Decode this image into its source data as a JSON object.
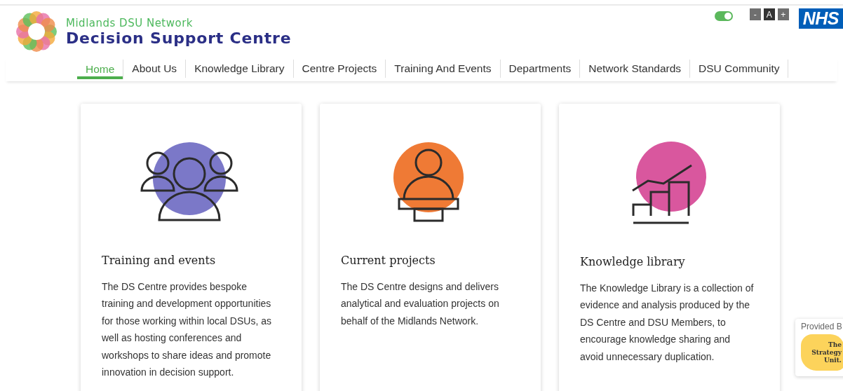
{
  "header": {
    "subtitle": "Midlands DSU Network",
    "title": "Decision Support Centre"
  },
  "contrast_toggle": {
    "on": true
  },
  "font_size_buttons": [
    {
      "label": "-",
      "selected": false
    },
    {
      "label": "A",
      "selected": true
    },
    {
      "label": "+",
      "selected": false
    }
  ],
  "nhs_logo": "NHS",
  "nav": [
    {
      "label": "Home",
      "selected": true
    },
    {
      "label": "About Us",
      "selected": false
    },
    {
      "label": "Knowledge Library",
      "selected": false
    },
    {
      "label": "Centre Projects",
      "selected": false
    },
    {
      "label": "Training And Events",
      "selected": false
    },
    {
      "label": "Departments",
      "selected": false
    },
    {
      "label": "Network Standards",
      "selected": false
    },
    {
      "label": "DSU Community",
      "selected": false
    }
  ],
  "cards": [
    {
      "kind": "people",
      "color": "#7b78c8",
      "title": "Training and events",
      "text": "The DS Centre provides bespoke training and development opportunities for those working within local DSUs, as well as hosting conferences and workshops to share ideas and promote innovation in decision support."
    },
    {
      "kind": "person",
      "color": "#ef7a35",
      "title": "Current projects",
      "text": "The DS Centre designs and delivers analytical and evaluation projects on behalf of the Midlands Network."
    },
    {
      "kind": "chart",
      "color": "#d9579e",
      "title": "Knowledge library",
      "text": "The Knowledge Library is a collection of evidence and analysis produced by the DS Centre and DSU Members, to encourage knowledge sharing and avoid unnecessary duplication."
    }
  ],
  "provider_badge": {
    "label": "Provided B",
    "logo_lines": [
      "The",
      "Strategy",
      "Unit."
    ]
  }
}
